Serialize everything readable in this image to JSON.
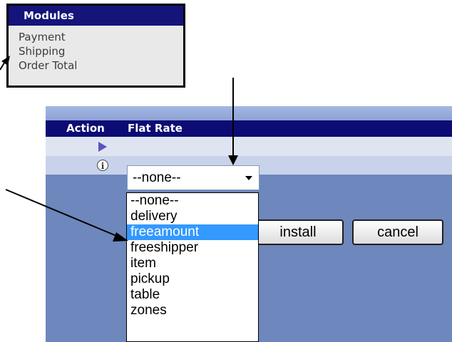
{
  "modules": {
    "header": "Modules",
    "items": [
      "Payment",
      "Shipping",
      "Order Total"
    ]
  },
  "panel": {
    "header_action": "Action",
    "header_flat_rate": "Flat Rate",
    "info_glyph": "i"
  },
  "select": {
    "value": "--none--",
    "options": [
      "--none--",
      "delivery",
      "freeamount",
      "freeshipper",
      "item",
      "pickup",
      "table",
      "zones"
    ],
    "highlighted": "freeamount"
  },
  "buttons": {
    "install": "install",
    "cancel": "cancel"
  },
  "icons": {
    "play": "play-icon",
    "info": "info-icon",
    "caret": "chevron-down-icon"
  },
  "colors": {
    "header_navy": "#0c0c74",
    "panel_blue": "#6e87bc",
    "highlight": "#3399ff"
  }
}
